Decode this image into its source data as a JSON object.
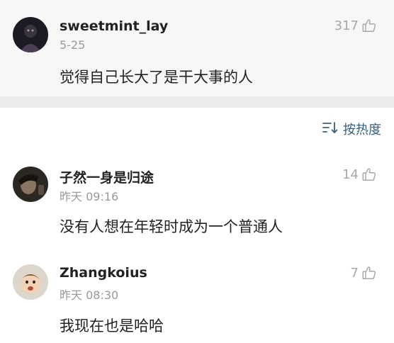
{
  "pinned_comment": {
    "username": "sweetmint_lay",
    "date": "5-25",
    "likes": "317",
    "text": "觉得自己长大了是干大事的人"
  },
  "sort": {
    "label": "按热度",
    "icon": "sort-icon"
  },
  "comments": [
    {
      "username": "子然一身是归途",
      "date": "昨天 09:16",
      "likes": "14",
      "text": "没有人想在年轻时成为一个普通人"
    },
    {
      "username": "Zhangkoius",
      "date": "昨天 08:30",
      "likes": "7",
      "text": "我现在也是哈哈"
    }
  ],
  "icons": {
    "like": "thumbs-up-icon"
  },
  "colors": {
    "accent": "#3a5f7d",
    "muted": "#9a9a9a",
    "pinned_bg": "#f7f7f7",
    "separator": "#ececec"
  }
}
